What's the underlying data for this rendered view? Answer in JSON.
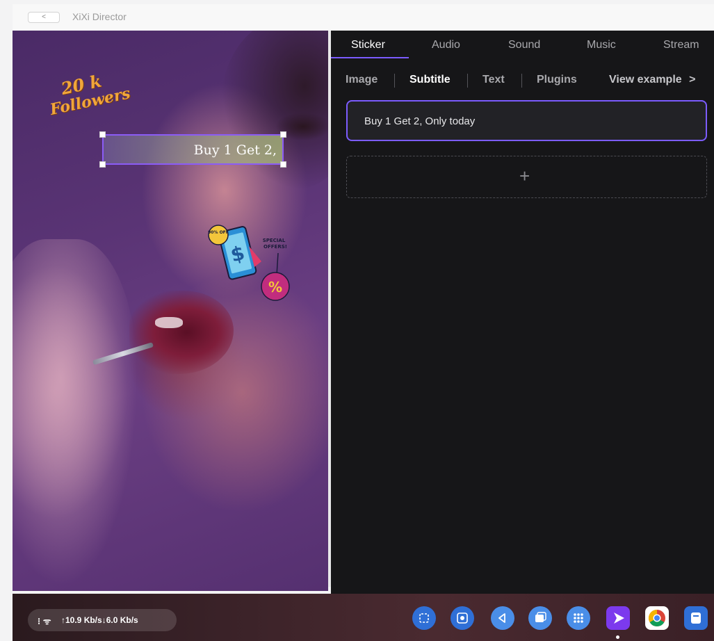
{
  "window": {
    "title": "XiXi Director",
    "back_label": "<"
  },
  "preview": {
    "sticker_followers": {
      "num": "20 k",
      "label": "Followers"
    },
    "sticker_offer": {
      "badge": "90% OFF",
      "special": "SPECIAL",
      "offers": "OFFERS!",
      "dollar": "$",
      "percent": "%"
    },
    "subtitle_overlay": "Buy 1 Get 2,"
  },
  "panel": {
    "tabs": [
      {
        "label": "Sticker",
        "active": true
      },
      {
        "label": "Audio"
      },
      {
        "label": "Sound"
      },
      {
        "label": "Music"
      },
      {
        "label": "Stream"
      }
    ],
    "subtabs": [
      {
        "label": "Image"
      },
      {
        "label": "Subtitle",
        "active": true
      },
      {
        "label": "Text"
      },
      {
        "label": "Plugins"
      }
    ],
    "view_example": "View example",
    "view_example_icon": ">",
    "subtitle_item": "Buy 1 Get 2, Only today",
    "add_symbol": "+"
  },
  "taskbar": {
    "network_icons": "⁝ ᯤ",
    "network_speed": "↑10.9 Kb/s↓6.0 Kb/s",
    "dock": [
      "screenshot-app",
      "screen-record-app",
      "back-app",
      "window-app",
      "apps-grid-app",
      "xixi-director-app",
      "chrome-app",
      "notes-app"
    ]
  },
  "colors": {
    "accent": "#7c5cff",
    "panel_bg": "#161618",
    "highlight_box": "#8b5cf6"
  }
}
